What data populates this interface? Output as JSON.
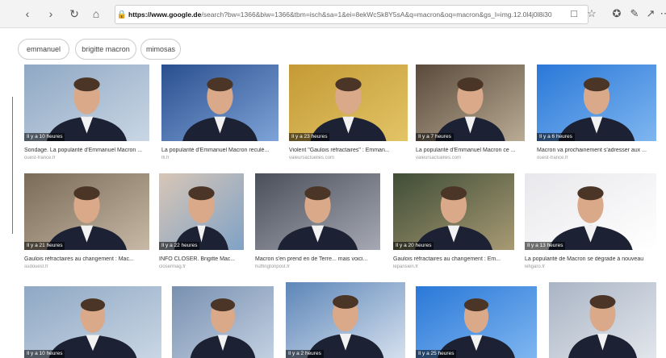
{
  "browser": {
    "url_host": "https://www.google.de",
    "url_path": "/search?bw=1366&biw=1366&tbm=isch&sa=1&ei=8ekWcSk8Y5sA&q=macron&oq=macron&gs_l=img.12.0l4j0l8i30"
  },
  "chips": [
    "emmanuel",
    "brigitte macron",
    "mimosas"
  ],
  "images": [
    {
      "badge": "Il y a 10 heures",
      "caption": "Sondage. La popularité d'Emmanuel Macron ...",
      "source": "ouest-france.fr"
    },
    {
      "badge": "",
      "caption": "La popularité d'Emmanuel Macron reculé...",
      "source": "lfi.fr"
    },
    {
      "badge": "Il y a 23 heures",
      "caption": "Violent \"Gaulois réfractaires\" : Emman...",
      "source": "valeursactuelles.com"
    },
    {
      "badge": "Il y a 7 heures",
      "caption": "La popularité d'Emmanuel Macron ce ...",
      "source": "valeursactuelles.com"
    },
    {
      "badge": "Il y a 6 heures",
      "caption": "Macron va prochainement s'adresser aux ...",
      "source": "ouest-france.fr"
    },
    {
      "badge": "Il y a 21 heures",
      "caption": "Gaulois réfractaires au changement : Mac...",
      "source": "sudouest.fr"
    },
    {
      "badge": "Il y a 22 heures",
      "caption": "INFO CLOSER. Brigitte Mac...",
      "source": "closermag.fr"
    },
    {
      "badge": "",
      "caption": "Macron s'en prend en de Terre... mais voici...",
      "source": "huffingtonpost.fr"
    },
    {
      "badge": "Il y a 20 heures",
      "caption": "Gaulois réfractaires au changement : Em...",
      "source": "leparisien.fr"
    },
    {
      "badge": "Il y a 13 heures",
      "caption": "La popularité de Macron se dégrade à nouveau",
      "source": "lefigaro.fr"
    },
    {
      "badge": "Il y a 10 heures",
      "caption": "",
      "source": ""
    },
    {
      "badge": "",
      "caption": "",
      "source": ""
    },
    {
      "badge": "Il y a 2 heures",
      "caption": "",
      "source": ""
    },
    {
      "badge": "Il y a 25 heures",
      "caption": "",
      "source": ""
    },
    {
      "badge": "",
      "caption": "",
      "source": ""
    }
  ],
  "colors": {
    "accent": "#1a73e8",
    "toolbar": "#f3f3f3"
  }
}
